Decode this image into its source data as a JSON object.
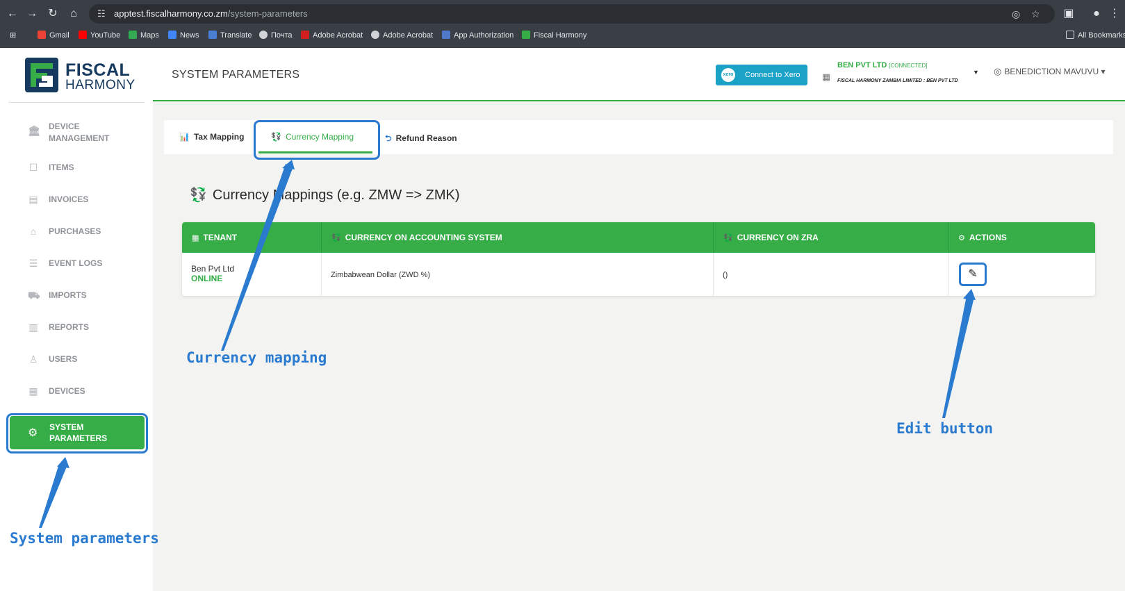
{
  "browser": {
    "url_host": "apptest.fiscalharmony.co.zm",
    "url_path": "/system-parameters",
    "bookmarks": [
      "Gmail",
      "YouTube",
      "Maps",
      "News",
      "Translate",
      "Почта",
      "Adobe Acrobat",
      "Adobe Acrobat",
      "App Authorization",
      "Fiscal Harmony"
    ],
    "all_bookmarks": "All Bookmarks"
  },
  "logo": {
    "line1": "FISCAL",
    "line2": "HARMONY"
  },
  "sidebar": {
    "items": [
      {
        "line1": "DEVICE",
        "line2": "MANAGEMENT",
        "icon": "bank-icon"
      },
      {
        "line1": "ITEMS",
        "icon": "box-icon"
      },
      {
        "line1": "INVOICES",
        "icon": "invoice-icon"
      },
      {
        "line1": "PURCHASES",
        "icon": "basket-icon"
      },
      {
        "line1": "EVENT LOGS",
        "icon": "log-icon"
      },
      {
        "line1": "IMPORTS",
        "icon": "cart-icon"
      },
      {
        "line1": "REPORTS",
        "icon": "chart-icon"
      },
      {
        "line1": "USERS",
        "icon": "user-icon"
      },
      {
        "line1": "DEVICES",
        "icon": "device-icon"
      }
    ],
    "active": {
      "line1": "SYSTEM",
      "line2": "PARAMETERS",
      "icon": "gear-icon"
    }
  },
  "header": {
    "title": "SYSTEM PARAMETERS",
    "xero_button": "Connect to Xero",
    "xero_logo": "xero",
    "org_name": "BEN PVT LTD",
    "org_status": "[CONNECTED]",
    "org_sub": "FISCAL HARMONY ZAMBIA LIMITED : BEN PVT LTD",
    "user": "BENEDICTION MAVUVU"
  },
  "tabs": [
    {
      "label": "Tax Mapping",
      "icon": "bar-chart-icon"
    },
    {
      "label": "Currency Mapping",
      "icon": "money-icon",
      "active": true
    },
    {
      "label": "Refund Reason",
      "icon": "refund-icon"
    }
  ],
  "section_title": "Currency Mappings (e.g. ZMW => ZMK)",
  "table": {
    "headers": [
      "TENANT",
      "CURRENCY ON ACCOUNTING SYSTEM",
      "CURRENCY ON ZRA",
      "ACTIONS"
    ],
    "rows": [
      {
        "tenant": "Ben Pvt Ltd",
        "status": "ONLINE",
        "accounting_currency": "Zimbabwean Dollar (ZWD %)",
        "zra_currency": "()"
      }
    ]
  },
  "annotations": {
    "currency_mapping": "Currency mapping",
    "edit_button": "Edit button",
    "system_parameters": "System parameters"
  },
  "colors": {
    "brand_green": "#36ad47",
    "annotation_blue": "#2a7bd0",
    "xero_blue": "#1ba2c7",
    "logo_navy": "#163a5f"
  }
}
